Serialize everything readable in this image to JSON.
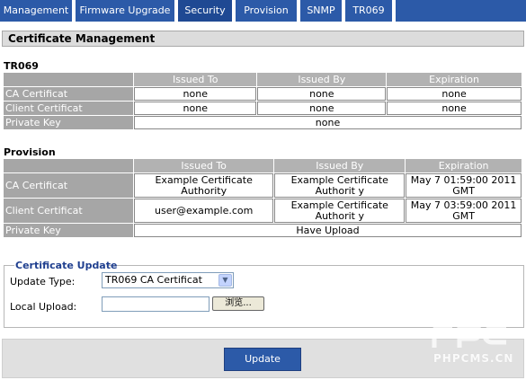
{
  "tabs": [
    {
      "label": "Management"
    },
    {
      "label": "Firmware Upgrade"
    },
    {
      "label": "Security"
    },
    {
      "label": "Provision"
    },
    {
      "label": "SNMP"
    },
    {
      "label": "TR069"
    }
  ],
  "page_title": "Certificate Management",
  "tr069": {
    "title": "TR069",
    "headers": [
      "Issued To",
      "Issued By",
      "Expiration"
    ],
    "rows": [
      {
        "label": "CA Certificat",
        "issued_to": "none",
        "issued_by": "none",
        "expiration": "none"
      },
      {
        "label": "Client Certificat",
        "issued_to": "none",
        "issued_by": "none",
        "expiration": "none"
      }
    ],
    "private_key_label": "Private Key",
    "private_key_value": "none"
  },
  "provision": {
    "title": "Provision",
    "headers": [
      "Issued To",
      "Issued By",
      "Expiration"
    ],
    "rows": [
      {
        "label": "CA Certificat",
        "issued_to": "Example Certificate Authority",
        "issued_by": "Example Certificate Authorit y",
        "expiration": "May 7 01:59:00 2011 GMT"
      },
      {
        "label": "Client Certificat",
        "issued_to": "user@example.com",
        "issued_by": "Example Certificate Authorit y",
        "expiration": "May 7 03:59:00 2011 GMT"
      }
    ],
    "private_key_label": "Private Key",
    "private_key_value": "Have Upload"
  },
  "update": {
    "legend": "Certificate Update",
    "type_label": "Update Type:",
    "type_value": "TR069 CA Certificat",
    "upload_label": "Local Upload:",
    "upload_value": "",
    "browse_label": "浏览...",
    "button_label": "Update"
  },
  "watermark": {
    "text": "PHPCMS.CN"
  },
  "colors": {
    "tab_blue": "#2c5aa8",
    "header_gray": "#b2b2b2"
  }
}
